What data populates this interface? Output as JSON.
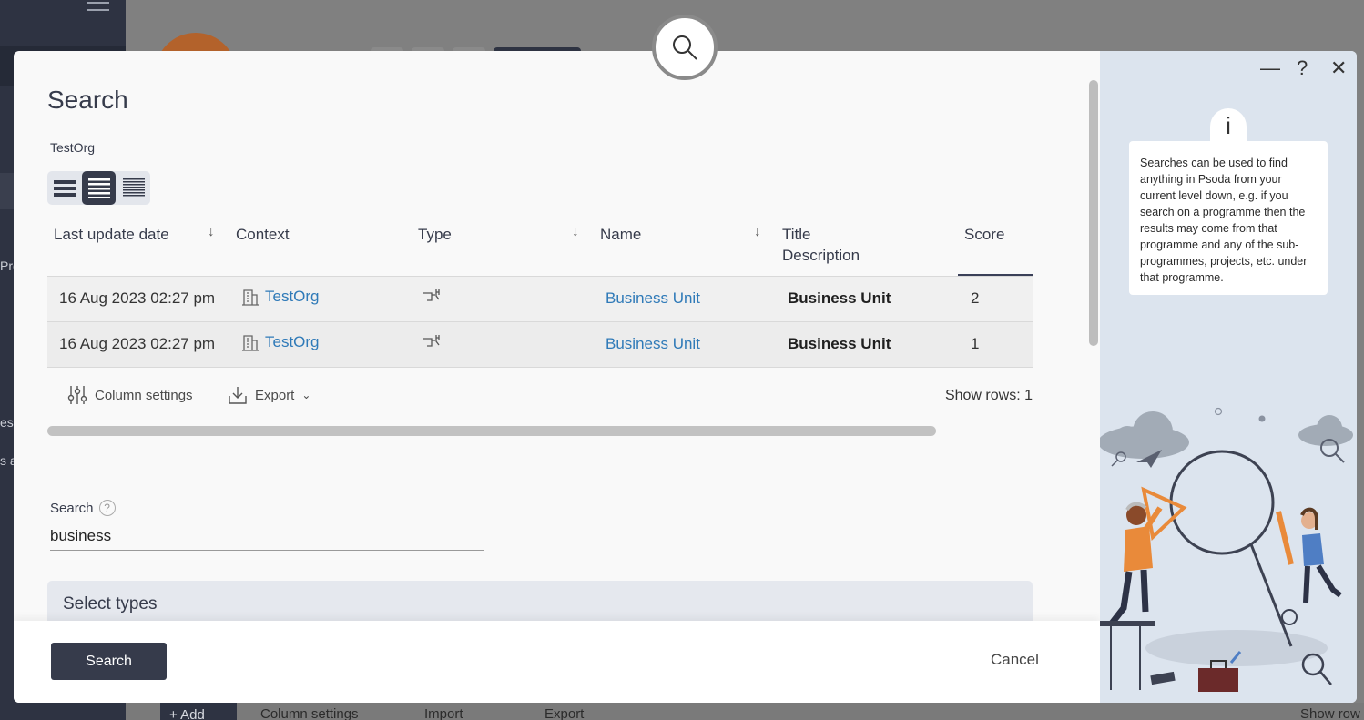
{
  "background": {
    "sidebar_fragments": [
      "Pro",
      "es",
      "s a"
    ],
    "bottom_toolbar": {
      "add_label": "Add",
      "column_settings_label": "Column settings",
      "import_label": "Import",
      "export_label": "Export",
      "show_rows_label": "Show row"
    }
  },
  "modal": {
    "title": "Search",
    "org": "TestOrg",
    "view_modes": [
      "compact-view-icon",
      "normal-view-icon",
      "dense-view-icon"
    ],
    "columns": {
      "last_update": "Last update date",
      "context": "Context",
      "type": "Type",
      "name": "Name",
      "title_line1": "Title",
      "title_line2": "Description",
      "score": "Score"
    },
    "rows": [
      {
        "date": "16 Aug 2023 02:27 pm",
        "context": "TestOrg",
        "name": "Business Unit",
        "title": "Business Unit",
        "score": "2"
      },
      {
        "date": "16 Aug 2023 02:27 pm",
        "context": "TestOrg",
        "name": "Business Unit",
        "title": "Business Unit",
        "score": "1"
      }
    ],
    "tools": {
      "column_settings": "Column settings",
      "export": "Export",
      "show_rows_label": "Show rows:",
      "show_rows_value": "1"
    },
    "search": {
      "label": "Search",
      "help": "?",
      "value": "business"
    },
    "select_types": "Select types",
    "footer": {
      "search_button": "Search",
      "cancel": "Cancel"
    }
  },
  "help_panel": {
    "minimize": "—",
    "help": "?",
    "close": "✕",
    "info_icon": "i",
    "text": "Searches can be used to find anything in Psoda from your current level down, e.g. if you search on a programme then the results may come from that programme and any of the sub-programmes, projects, etc. under that programme."
  },
  "colors": {
    "primary": "#363b4b",
    "link": "#2f7ab8",
    "panel": "#dce4ee",
    "accent": "#e98a3a"
  }
}
